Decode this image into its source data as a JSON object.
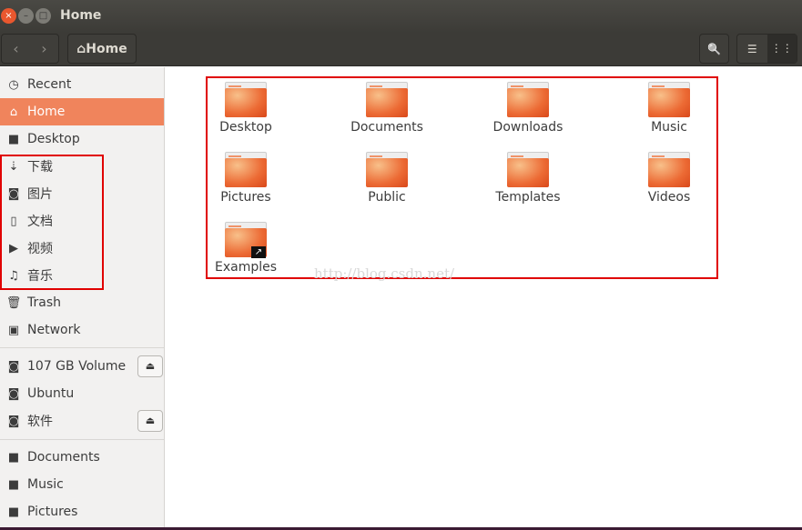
{
  "window": {
    "title": "Home",
    "close": "×",
    "minimize": "–",
    "maximize": "□"
  },
  "toolbar": {
    "back": "‹",
    "forward": "›",
    "path_icon": "⌂",
    "path_label": "Home",
    "search_icon": "🔍",
    "list_view": "☰",
    "grid_view": "⋮⋮"
  },
  "sidebar": {
    "items": [
      {
        "icon": "◷",
        "label": "Recent"
      },
      {
        "icon": "⌂",
        "label": "Home"
      },
      {
        "icon": "■",
        "label": "Desktop"
      },
      {
        "icon": "⇣",
        "label": "下载"
      },
      {
        "icon": "◙",
        "label": "图片"
      },
      {
        "icon": "▯",
        "label": "文档"
      },
      {
        "icon": "▶",
        "label": "视频"
      },
      {
        "icon": "♫",
        "label": "音乐"
      },
      {
        "icon": "🗑",
        "label": "Trash"
      },
      {
        "icon": "▣",
        "label": "Network"
      }
    ],
    "devices": [
      {
        "icon": "◙",
        "label": "107 GB Volume",
        "eject": "⏏"
      },
      {
        "icon": "◙",
        "label": "Ubuntu"
      },
      {
        "icon": "◙",
        "label": "软件",
        "eject": "⏏"
      }
    ],
    "bookmarks": [
      {
        "icon": "■",
        "label": "Documents"
      },
      {
        "icon": "■",
        "label": "Music"
      },
      {
        "icon": "■",
        "label": "Pictures"
      }
    ]
  },
  "folders": [
    "Desktop",
    "Documents",
    "Downloads",
    "Music",
    "Pictures",
    "Public",
    "Templates",
    "Videos",
    "Examples"
  ],
  "link_emblem": "↗",
  "watermark": "http://blog.csdn.net/"
}
